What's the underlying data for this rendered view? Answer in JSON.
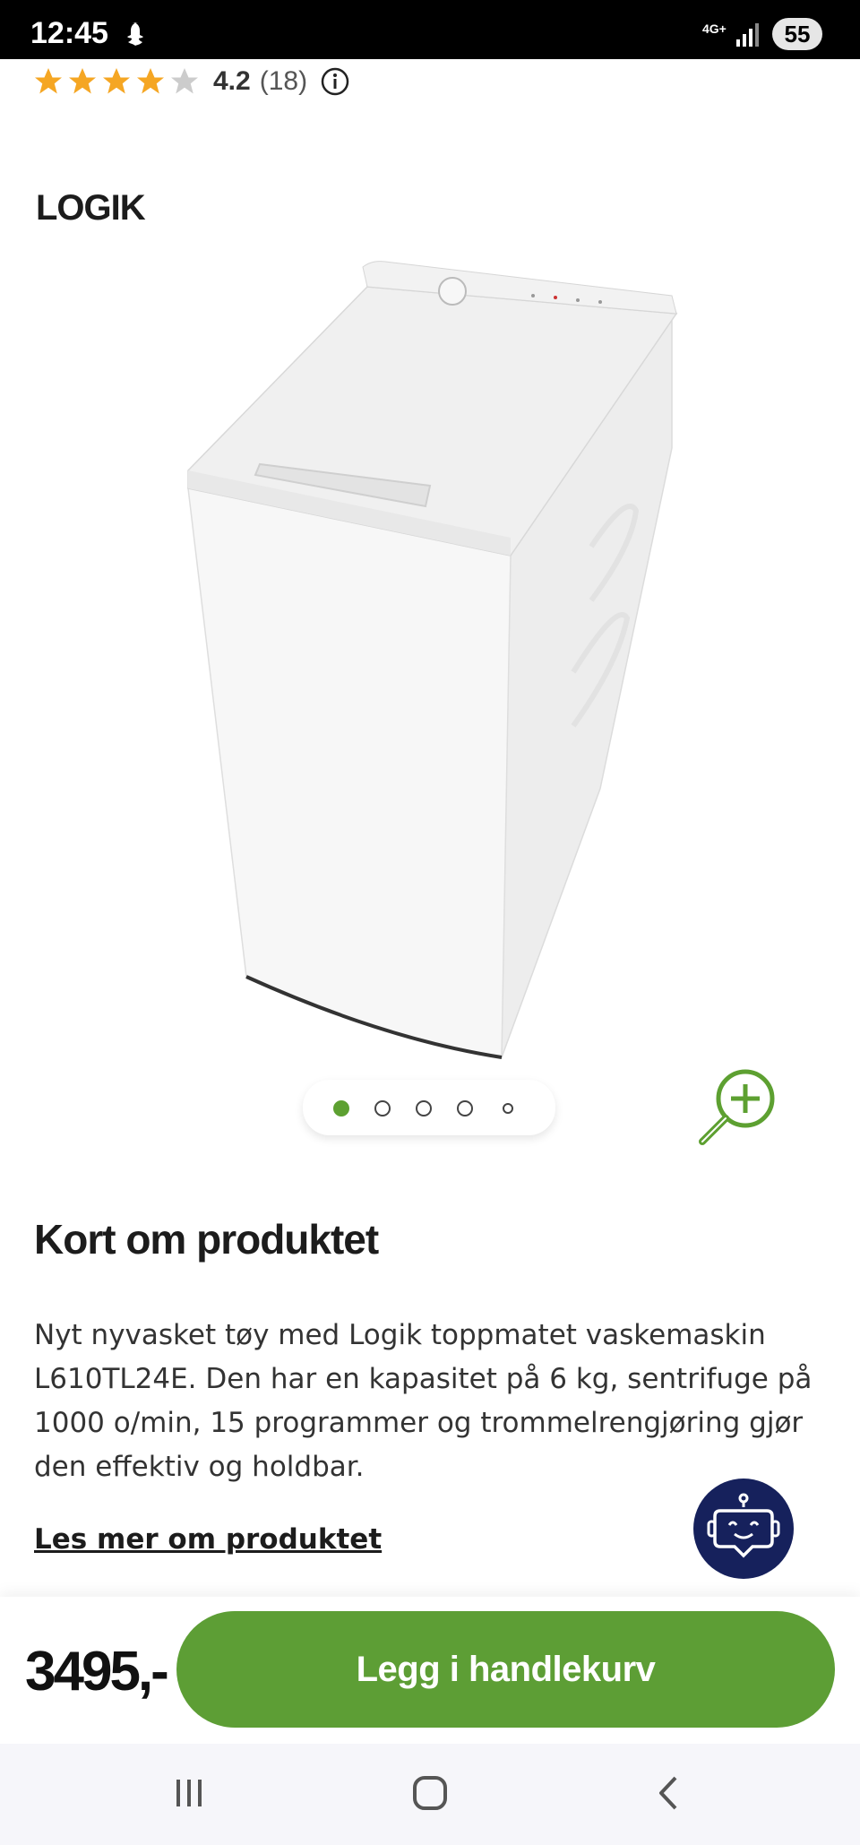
{
  "status_bar": {
    "time": "12:45",
    "network": "4G+",
    "battery": "55"
  },
  "rating": {
    "stars_filled": 4,
    "stars_total": 5,
    "score": "4.2",
    "count": "(18)",
    "star_color": "#f5a623"
  },
  "brand": {
    "logo_text": "LOGIK"
  },
  "gallery": {
    "image_count": 5,
    "active_index": 0,
    "accent_color": "#5da031"
  },
  "about": {
    "title": "Kort om produktet",
    "description": "Nyt nyvasket tøy med Logik toppmatet vaskemaskin L610TL24E. Den har en kapasitet på 6 kg, sentrifuge på 1000 o/min, 15 programmer og trommelrengjøring gjør den effektiv og holdbar.",
    "read_more": "Les mer om produktet"
  },
  "purchase": {
    "price": "3495,-",
    "add_to_cart": "Legg i handlekurv",
    "button_color": "#5d9e35"
  },
  "icons": {
    "status": [
      "ghost-icon",
      "signal-icon"
    ],
    "rating": [
      "star-icon",
      "info-icon"
    ],
    "gallery": [
      "zoom-in-icon"
    ],
    "chat": "chatbot-icon",
    "nav": [
      "recent-apps-icon",
      "home-icon",
      "back-icon"
    ]
  }
}
